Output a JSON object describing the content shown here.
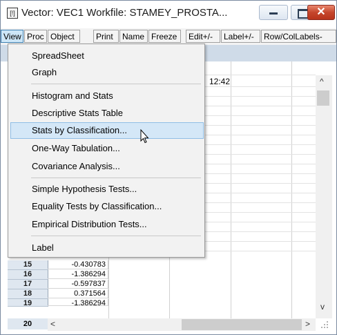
{
  "window": {
    "icon_label": "[!]",
    "title": "Vector: VEC1    Workfile: STAMEY_PROSTA...",
    "close_glyph": "✕"
  },
  "toolbar": {
    "buttons": [
      "View",
      "Proc",
      "Object",
      "Print",
      "Name",
      "Freeze",
      "Edit+/-",
      "Label+/-",
      "Row/ColLabels-"
    ]
  },
  "grid": {
    "time_text": "12:42",
    "rows": [
      {
        "num": "15",
        "value": "-0.430783"
      },
      {
        "num": "16",
        "value": "-1.386294"
      },
      {
        "num": "17",
        "value": "-0.597837"
      },
      {
        "num": "18",
        "value": "0.371564"
      },
      {
        "num": "19",
        "value": "-1.386294"
      },
      {
        "num": "20",
        "value": ""
      }
    ]
  },
  "scrollbars": {
    "up": "^",
    "down": "v",
    "left": "<",
    "right": ">"
  },
  "menu": {
    "items": [
      {
        "label": "SpreadSheet"
      },
      {
        "label": "Graph"
      },
      {
        "label": "Histogram and Stats"
      },
      {
        "label": "Descriptive Stats Table"
      },
      {
        "label": "Stats by Classification..."
      },
      {
        "label": "One-Way Tabulation..."
      },
      {
        "label": "Covariance Analysis..."
      },
      {
        "label": "Simple Hypothesis Tests..."
      },
      {
        "label": "Equality Tests by Classification..."
      },
      {
        "label": "Empirical Distribution Tests..."
      },
      {
        "label": "Label"
      }
    ],
    "highlighted": "Stats by Classification..."
  },
  "colors": {
    "accent": "#cde6f7",
    "highlight": "#d4e7f7",
    "close": "#c5462c",
    "header_strip": "#cfdbe8"
  }
}
